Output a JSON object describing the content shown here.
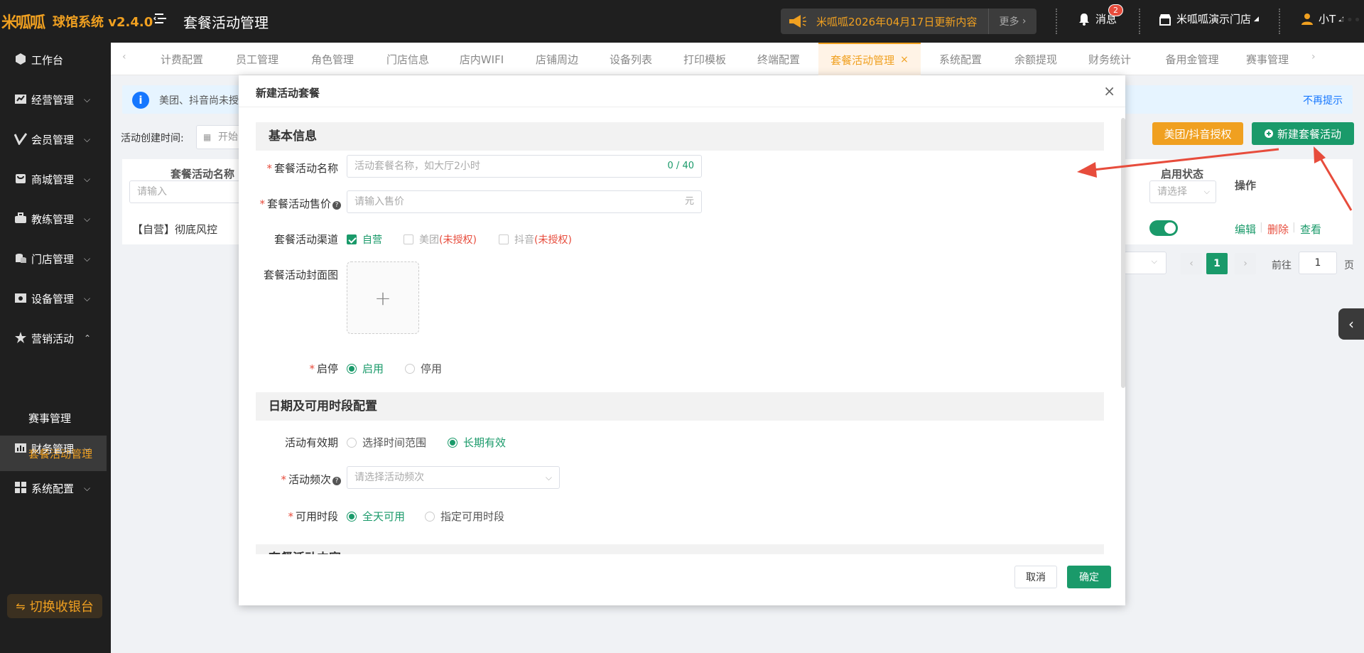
{
  "app": {
    "logo_text": "米呱呱",
    "brand": "球馆系统 v2.4.0",
    "page_heading": "套餐活动管理",
    "notice_text": "米呱呱2026年04月17日更新内容",
    "notice_more": "更多",
    "messages_label": "消息",
    "messages_badge": "2",
    "store_name": "米呱呱演示门店",
    "user_name": "小T"
  },
  "sidebar": {
    "items": [
      {
        "label": "工作台",
        "icon": "cube-icon"
      },
      {
        "label": "经营管理",
        "icon": "chart-icon"
      },
      {
        "label": "会员管理",
        "icon": "check-icon"
      },
      {
        "label": "商城管理",
        "icon": "shop-icon"
      },
      {
        "label": "教练管理",
        "icon": "coach-icon"
      },
      {
        "label": "门店管理",
        "icon": "coins-icon"
      },
      {
        "label": "设备管理",
        "icon": "device-icon"
      },
      {
        "label": "营销活动",
        "icon": "star-icon"
      },
      {
        "label": "财务管理",
        "icon": "finance-icon"
      },
      {
        "label": "系统配置",
        "icon": "grid-icon"
      }
    ],
    "sub_items": [
      {
        "label": "赛事管理"
      },
      {
        "label": "套餐活动管理",
        "active": true
      }
    ],
    "switch_button": "切换收银台"
  },
  "tabs": [
    {
      "label": "计费配置"
    },
    {
      "label": "员工管理"
    },
    {
      "label": "角色管理"
    },
    {
      "label": "门店信息"
    },
    {
      "label": "店内WIFI"
    },
    {
      "label": "店铺周边"
    },
    {
      "label": "设备列表"
    },
    {
      "label": "打印模板"
    },
    {
      "label": "终端配置"
    },
    {
      "label": "套餐活动管理",
      "active": true
    },
    {
      "label": "系统配置"
    },
    {
      "label": "余额提现"
    },
    {
      "label": "财务统计"
    },
    {
      "label": "备用金管理"
    },
    {
      "label": "赛事管理"
    }
  ],
  "background": {
    "tip_text": "美团、抖音尚未授",
    "tip_dismiss": "不再提示",
    "filter_label": "活动创建时间:",
    "date_placeholder": "开始",
    "btn_auth": "美团/抖音授权",
    "btn_new": "新建套餐活动",
    "col_name": "套餐活动名称",
    "col_name_placeholder": "请输入",
    "col_status": "启用状态",
    "col_status_placeholder": "请选择",
    "col_ops": "操作",
    "row_name": "【自营】彻底风控",
    "row_status_on": true,
    "op_edit": "编辑",
    "op_delete": "删除",
    "op_view": "查看",
    "page_current": "1",
    "goto_label": "前往",
    "goto_value": "1",
    "goto_unit": "页"
  },
  "modal": {
    "title": "新建活动套餐",
    "section_basic": "基本信息",
    "name_label": "套餐活动名称",
    "name_placeholder": "活动套餐名称，如大厅2小时",
    "name_count": "0 / 40",
    "price_label": "套餐活动售价",
    "price_placeholder": "请输入售价",
    "price_unit": "元",
    "channel_label": "套餐活动渠道",
    "channel_self": "自营",
    "channel_meituan": "美团",
    "channel_douyin": "抖音",
    "unauthorized": "(未授权)",
    "cover_label": "套餐活动封面图",
    "cover_plus": "+",
    "toggle_label": "启停",
    "toggle_on": "启用",
    "toggle_off": "停用",
    "section_date": "日期及可用时段配置",
    "validity_label": "活动有效期",
    "validity_range": "选择时间范围",
    "validity_long": "长期有效",
    "frequency_label": "活动频次",
    "frequency_placeholder": "请选择活动频次",
    "period_label": "可用时段",
    "period_all": "全天可用",
    "period_custom": "指定可用时段",
    "section_content": "套餐活动内容",
    "cancel": "取消",
    "confirm": "确定"
  },
  "colors": {
    "accent": "#f0a020",
    "primary": "#1a9a6a",
    "danger": "#e74c3c",
    "topbar": "#1f1f1f"
  }
}
